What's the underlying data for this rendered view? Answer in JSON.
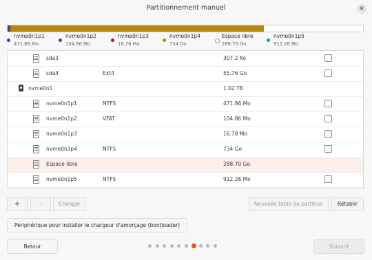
{
  "window": {
    "title": "Partitionnement manuel"
  },
  "usage": {
    "segments": [
      {
        "name": "nvme0n1p1",
        "size": "471.86 Mo",
        "color": "#1f4e9a",
        "fraction": 0.0046
      },
      {
        "name": "nvme0n1p2",
        "size": "104.86 Mo",
        "color": "#7b2a8e",
        "fraction": 0.001
      },
      {
        "name": "nvme0n1p3",
        "size": "16.78 Mo",
        "color": "#a11a2e",
        "fraction": 0.0002
      },
      {
        "name": "nvme0n1p4",
        "size": "734 Go",
        "color": "#b8860b",
        "fraction": 0.712
      },
      {
        "name": "Espace libre",
        "size": "288.70 Go",
        "color": "#ffffff",
        "fraction": 0.28
      },
      {
        "name": "nvme0n1p5",
        "size": "912.26 Mo",
        "color": "#2e9e5b",
        "fraction": 0.009
      }
    ]
  },
  "table": {
    "rows": [
      {
        "icon": "partition-icon",
        "name": "sda3",
        "type": "",
        "size": "307.2 Ko",
        "selected": false
      },
      {
        "icon": "partition-icon",
        "name": "sda4",
        "type": "Ext4",
        "size": "55.76 Go",
        "selected": false
      },
      {
        "icon": "disk-icon",
        "name": "nvme0n1",
        "type": "",
        "size": "1.02 TB",
        "selected": false,
        "disk": true
      },
      {
        "icon": "partition-icon",
        "name": "nvme0n1p1",
        "type": "NTFS",
        "size": "471.86 Mo",
        "selected": false
      },
      {
        "icon": "partition-icon",
        "name": "nvme0n1p2",
        "type": "VFAT",
        "size": "104.86 Mo",
        "selected": false
      },
      {
        "icon": "partition-icon",
        "name": "nvme0n1p3",
        "type": "",
        "size": "16.78 Mo",
        "selected": false
      },
      {
        "icon": "partition-icon",
        "name": "nvme0n1p4",
        "type": "NTFS",
        "size": "734 Go",
        "selected": false
      },
      {
        "icon": "partition-icon",
        "name": "Espace libre",
        "type": "",
        "size": "288.70 Go",
        "selected": true
      },
      {
        "icon": "partition-icon",
        "name": "nvme0n1p5",
        "type": "NTFS",
        "size": "912.26 Mo",
        "selected": false
      }
    ]
  },
  "toolbar": {
    "add": "+",
    "remove": "−",
    "change": "Changer",
    "new_table": "Nouvelle table de partition",
    "restore": "Rétablir"
  },
  "bootloader": {
    "label": "Périphérique pour installer le chargeur d'amorçage (bootloader)"
  },
  "footer": {
    "back": "Retour",
    "next": "Suivant",
    "steps_total": 10,
    "step_current": 7
  }
}
